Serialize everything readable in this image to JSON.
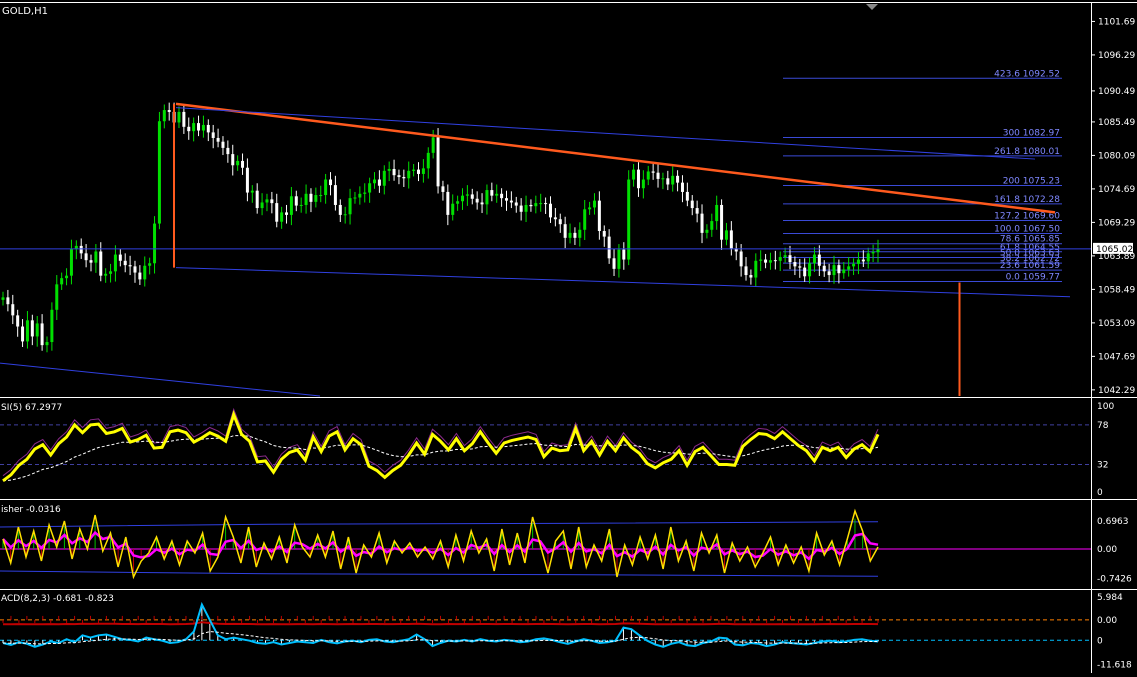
{
  "colors": {
    "background": "#000000",
    "axis": "#ffffff",
    "bull": "#00e000",
    "bear": "#ffffff",
    "trend": "#ff5a1e",
    "fib": "#3a4ad6",
    "fibText": "#7f88ff",
    "channel": "#3040e0",
    "rsi": "#ffff00",
    "rsiSignal": "#ffffff",
    "rsiEnvelope": "#8a2a8a",
    "fisher": "#ffe000",
    "fisherSignal": "#ff00ff",
    "fisherHistUp": "#00c000",
    "fisherHistDown": "#c00000",
    "fisherBand": "#3040e0",
    "fisherZero": "#ff00ff",
    "macdMain": "#00c0ff",
    "macdSignal": "#c00000",
    "macdHist": "#ffffff",
    "macdLevel": "#ff7f00",
    "dashed": "#4040a0",
    "pricePlate": "#ffffff"
  },
  "chart_data": [
    {
      "id": "price",
      "type": "candlestick",
      "title": "GOLD,H1",
      "ylim": [
        1041.3,
        1104.5
      ],
      "yticks": [
        "1101.69",
        "1096.29",
        "1090.49",
        "1085.49",
        "1080.09",
        "1074.69",
        "1069.29",
        "1063.89",
        "1058.49",
        "1053.09",
        "1047.69",
        "1042.29"
      ],
      "current_price": "1065.02",
      "fibonacci": [
        {
          "label": "423.6 1092.52",
          "value": 1092.52
        },
        {
          "label": "300 1082.97",
          "value": 1082.97
        },
        {
          "label": "261.8 1080.01",
          "value": 1080.01
        },
        {
          "label": "200 1075.23",
          "value": 1075.23
        },
        {
          "label": "161.8 1072.28",
          "value": 1072.28
        },
        {
          "label": "127.2 1069.60",
          "value": 1069.6
        },
        {
          "label": "100.0 1067.50",
          "value": 1067.5
        },
        {
          "label": "78.6 1065.85",
          "value": 1065.85
        },
        {
          "label": "61.8 1064.55",
          "value": 1064.55
        },
        {
          "label": "50.0 1063.63",
          "value": 1063.63
        },
        {
          "label": "38.2 1062.72",
          "value": 1062.72
        },
        {
          "label": "23.6 1061.59",
          "value": 1061.59
        },
        {
          "label": "0.0 1059.77",
          "value": 1059.77
        }
      ],
      "closes": [
        1057.2,
        1056.1,
        1054.3,
        1052.5,
        1050.1,
        1053.5,
        1050.9,
        1053.0,
        1049.5,
        1050.0,
        1055.2,
        1059.3,
        1060.3,
        1060.7,
        1065.0,
        1065.5,
        1064.3,
        1063.2,
        1062.8,
        1064.6,
        1060.7,
        1061.0,
        1061.4,
        1064.1,
        1063.1,
        1062.4,
        1062.2,
        1061.2,
        1060.1,
        1062.3,
        1062.7,
        1069.1,
        1085.6,
        1087.4,
        1087.1,
        1085.4,
        1087.1,
        1084.7,
        1084.0,
        1085.3,
        1084.1,
        1085.0,
        1083.8,
        1082.9,
        1082.3,
        1081.3,
        1080.3,
        1078.5,
        1079.2,
        1078.1,
        1074.1,
        1074.4,
        1071.6,
        1072.5,
        1073.0,
        1072.4,
        1069.4,
        1070.9,
        1070.5,
        1073.5,
        1072.0,
        1072.1,
        1073.9,
        1072.6,
        1073.7,
        1073.7,
        1076.2,
        1075.3,
        1072.1,
        1070.5,
        1070.6,
        1073.2,
        1073.3,
        1073.9,
        1074.1,
        1075.6,
        1076.2,
        1075.2,
        1077.6,
        1077.9,
        1076.9,
        1076.6,
        1076.4,
        1077.6,
        1077.8,
        1077.1,
        1078.0,
        1080.5,
        1083.0,
        1075.1,
        1074.2,
        1070.5,
        1072.3,
        1072.7,
        1073.6,
        1073.8,
        1073.1,
        1072.5,
        1072.2,
        1074.5,
        1073.6,
        1073.9,
        1073.2,
        1072.8,
        1072.5,
        1072.0,
        1071.0,
        1072.1,
        1071.9,
        1072.4,
        1072.4,
        1072.3,
        1070.1,
        1069.8,
        1069.0,
        1066.8,
        1067.6,
        1066.8,
        1068.1,
        1071.4,
        1071.7,
        1072.8,
        1067.9,
        1067.0,
        1063.5,
        1061.8,
        1064.9,
        1063.3,
        1076.2,
        1077.8,
        1074.8,
        1076.2,
        1077.5,
        1077.3,
        1076.3,
        1076.4,
        1075.4,
        1076.8,
        1075.7,
        1074.2,
        1072.8,
        1071.6,
        1070.7,
        1067.6,
        1068.1,
        1069.5,
        1072.1,
        1066.5,
        1068.0,
        1065.1,
        1064.6,
        1062.2,
        1060.8,
        1060.4,
        1063.1,
        1063.3,
        1062.8,
        1063.2,
        1063.1,
        1063.7,
        1064.0,
        1062.9,
        1062.2,
        1062.0,
        1060.6,
        1062.7,
        1064.1,
        1062.3,
        1061.4,
        1060.8,
        1062.4,
        1061.1,
        1061.7,
        1062.2,
        1062.6,
        1063.3,
        1063.0,
        1064.3,
        1064.5,
        1065.0
      ]
    },
    {
      "id": "rsi",
      "type": "line",
      "title": "SI(5) 67.2977",
      "ylim": [
        0,
        100
      ],
      "levels": [
        {
          "label": "78",
          "value": 78
        },
        {
          "label": "32",
          "value": 32
        }
      ],
      "yticks": [
        {
          "label": "100",
          "value": 100
        },
        {
          "label": "78",
          "value": 78
        },
        {
          "label": "32",
          "value": 32
        },
        {
          "label": "0",
          "value": 0
        }
      ],
      "values": [
        13,
        20,
        31,
        38,
        50,
        55,
        43,
        56,
        64,
        78,
        69,
        78,
        79,
        68,
        70,
        74,
        58,
        61,
        66,
        51,
        52,
        70,
        72,
        69,
        58,
        63,
        69,
        65,
        59,
        90,
        67,
        59,
        35,
        36,
        23,
        38,
        46,
        49,
        37,
        64,
        47,
        65,
        70,
        49,
        62,
        55,
        30,
        25,
        17,
        25,
        31,
        43,
        57,
        44,
        67,
        59,
        49,
        62,
        48,
        56,
        70,
        57,
        45,
        57,
        60,
        62,
        64,
        61,
        41,
        51,
        48,
        49,
        74,
        48,
        59,
        43,
        59,
        48,
        63,
        52,
        45,
        33,
        28,
        34,
        38,
        48,
        31,
        47,
        52,
        42,
        32,
        32,
        31,
        53,
        61,
        68,
        67,
        62,
        70,
        62,
        54,
        48,
        36,
        52,
        48,
        52,
        40,
        50,
        55,
        47,
        67
      ]
    },
    {
      "id": "fisher",
      "type": "line",
      "title": "isher -0.0316",
      "ylim": [
        -0.95,
        1.15
      ],
      "yticks": [
        {
          "label": "0.6963",
          "value": 0.6963
        },
        {
          "label": "0.00",
          "value": 0
        },
        {
          "label": "-0.7426",
          "value": -0.7426
        }
      ],
      "values": [
        0.25,
        -0.35,
        0.55,
        -0.2,
        0.45,
        -0.3,
        0.6,
        0.05,
        0.7,
        -0.25,
        0.5,
        0.0,
        0.85,
        -0.05,
        0.4,
        -0.45,
        0.3,
        -0.7,
        -0.3,
        -0.1,
        0.3,
        -0.25,
        0.2,
        -0.4,
        0.2,
        -0.1,
        0.4,
        -0.55,
        -0.2,
        0.8,
        0.3,
        -0.35,
        0.55,
        -0.45,
        0.15,
        -0.25,
        0.3,
        -0.35,
        0.6,
        0.05,
        -0.2,
        0.35,
        -0.2,
        0.45,
        -0.5,
        0.3,
        -0.6,
        0.1,
        -0.2,
        0.4,
        -0.35,
        0.2,
        -0.1,
        0.15,
        -0.2,
        0.05,
        -0.25,
        0.2,
        -0.45,
        0.35,
        -0.3,
        0.45,
        -0.1,
        0.25,
        -0.55,
        0.5,
        -0.4,
        0.4,
        -0.35,
        0.8,
        0.1,
        -0.6,
        0.2,
        0.45,
        -0.5,
        0.55,
        -0.45,
        0.1,
        -0.3,
        0.5,
        -0.7,
        0.1,
        -0.4,
        0.3,
        -0.25,
        0.35,
        -0.5,
        0.55,
        -0.3,
        0.2,
        -0.55,
        0.4,
        -0.1,
        0.35,
        -0.6,
        0.15,
        -0.3,
        0.05,
        -0.45,
        -0.1,
        0.3,
        -0.4,
        0.1,
        -0.35,
        0.05,
        -0.55,
        0.4,
        -0.15,
        0.2,
        -0.4,
        0.25,
        0.95,
        0.45,
        -0.3,
        0.05
      ]
    },
    {
      "id": "macd",
      "type": "line",
      "title": "ACD(8,2,3) -0.681 -0.823",
      "ylim": [
        -12.5,
        7.0
      ],
      "yticks": [
        {
          "label": "5.984",
          "value": 5.984
        },
        {
          "label": "0.00",
          "value": 0
        },
        {
          "label": "0",
          "value": -5.3
        },
        {
          "label": "-11.618",
          "value": -11.618
        }
      ],
      "values": [
        -6.0,
        -6.5,
        -5.8,
        -6.2,
        -7.0,
        -6.4,
        -5.6,
        -6.0,
        -5.0,
        -5.8,
        -4.0,
        -4.6,
        -4.0,
        -3.8,
        -4.4,
        -5.0,
        -5.2,
        -5.6,
        -4.6,
        -5.0,
        -5.4,
        -6.0,
        -5.8,
        -5.0,
        -3.0,
        4.0,
        0.0,
        -4.0,
        -5.0,
        -4.6,
        -5.0,
        -5.4,
        -6.0,
        -6.2,
        -5.8,
        -6.4,
        -6.0,
        -5.6,
        -5.8,
        -6.0,
        -5.2,
        -5.8,
        -6.1,
        -5.6,
        -5.4,
        -5.8,
        -5.2,
        -5.0,
        -5.6,
        -5.8,
        -5.4,
        -5.0,
        -3.8,
        -5.0,
        -6.8,
        -6.0,
        -5.4,
        -5.6,
        -5.2,
        -5.6,
        -5.0,
        -5.4,
        -5.6,
        -5.2,
        -5.4,
        -5.8,
        -5.6,
        -5.0,
        -4.8,
        -5.2,
        -5.8,
        -6.2,
        -5.6,
        -5.0,
        -5.4,
        -6.0,
        -5.8,
        -5.4,
        -2.0,
        -2.4,
        -4.0,
        -5.4,
        -6.4,
        -7.0,
        -6.2,
        -5.8,
        -6.6,
        -6.8,
        -6.0,
        -5.6,
        -4.6,
        -4.8,
        -6.4,
        -6.6,
        -6.0,
        -6.2,
        -6.8,
        -6.4,
        -5.8,
        -6.0,
        -6.2,
        -6.4,
        -6.0,
        -5.6,
        -5.4,
        -5.8,
        -5.6,
        -5.2,
        -5.0,
        -5.4,
        -5.6
      ]
    }
  ]
}
